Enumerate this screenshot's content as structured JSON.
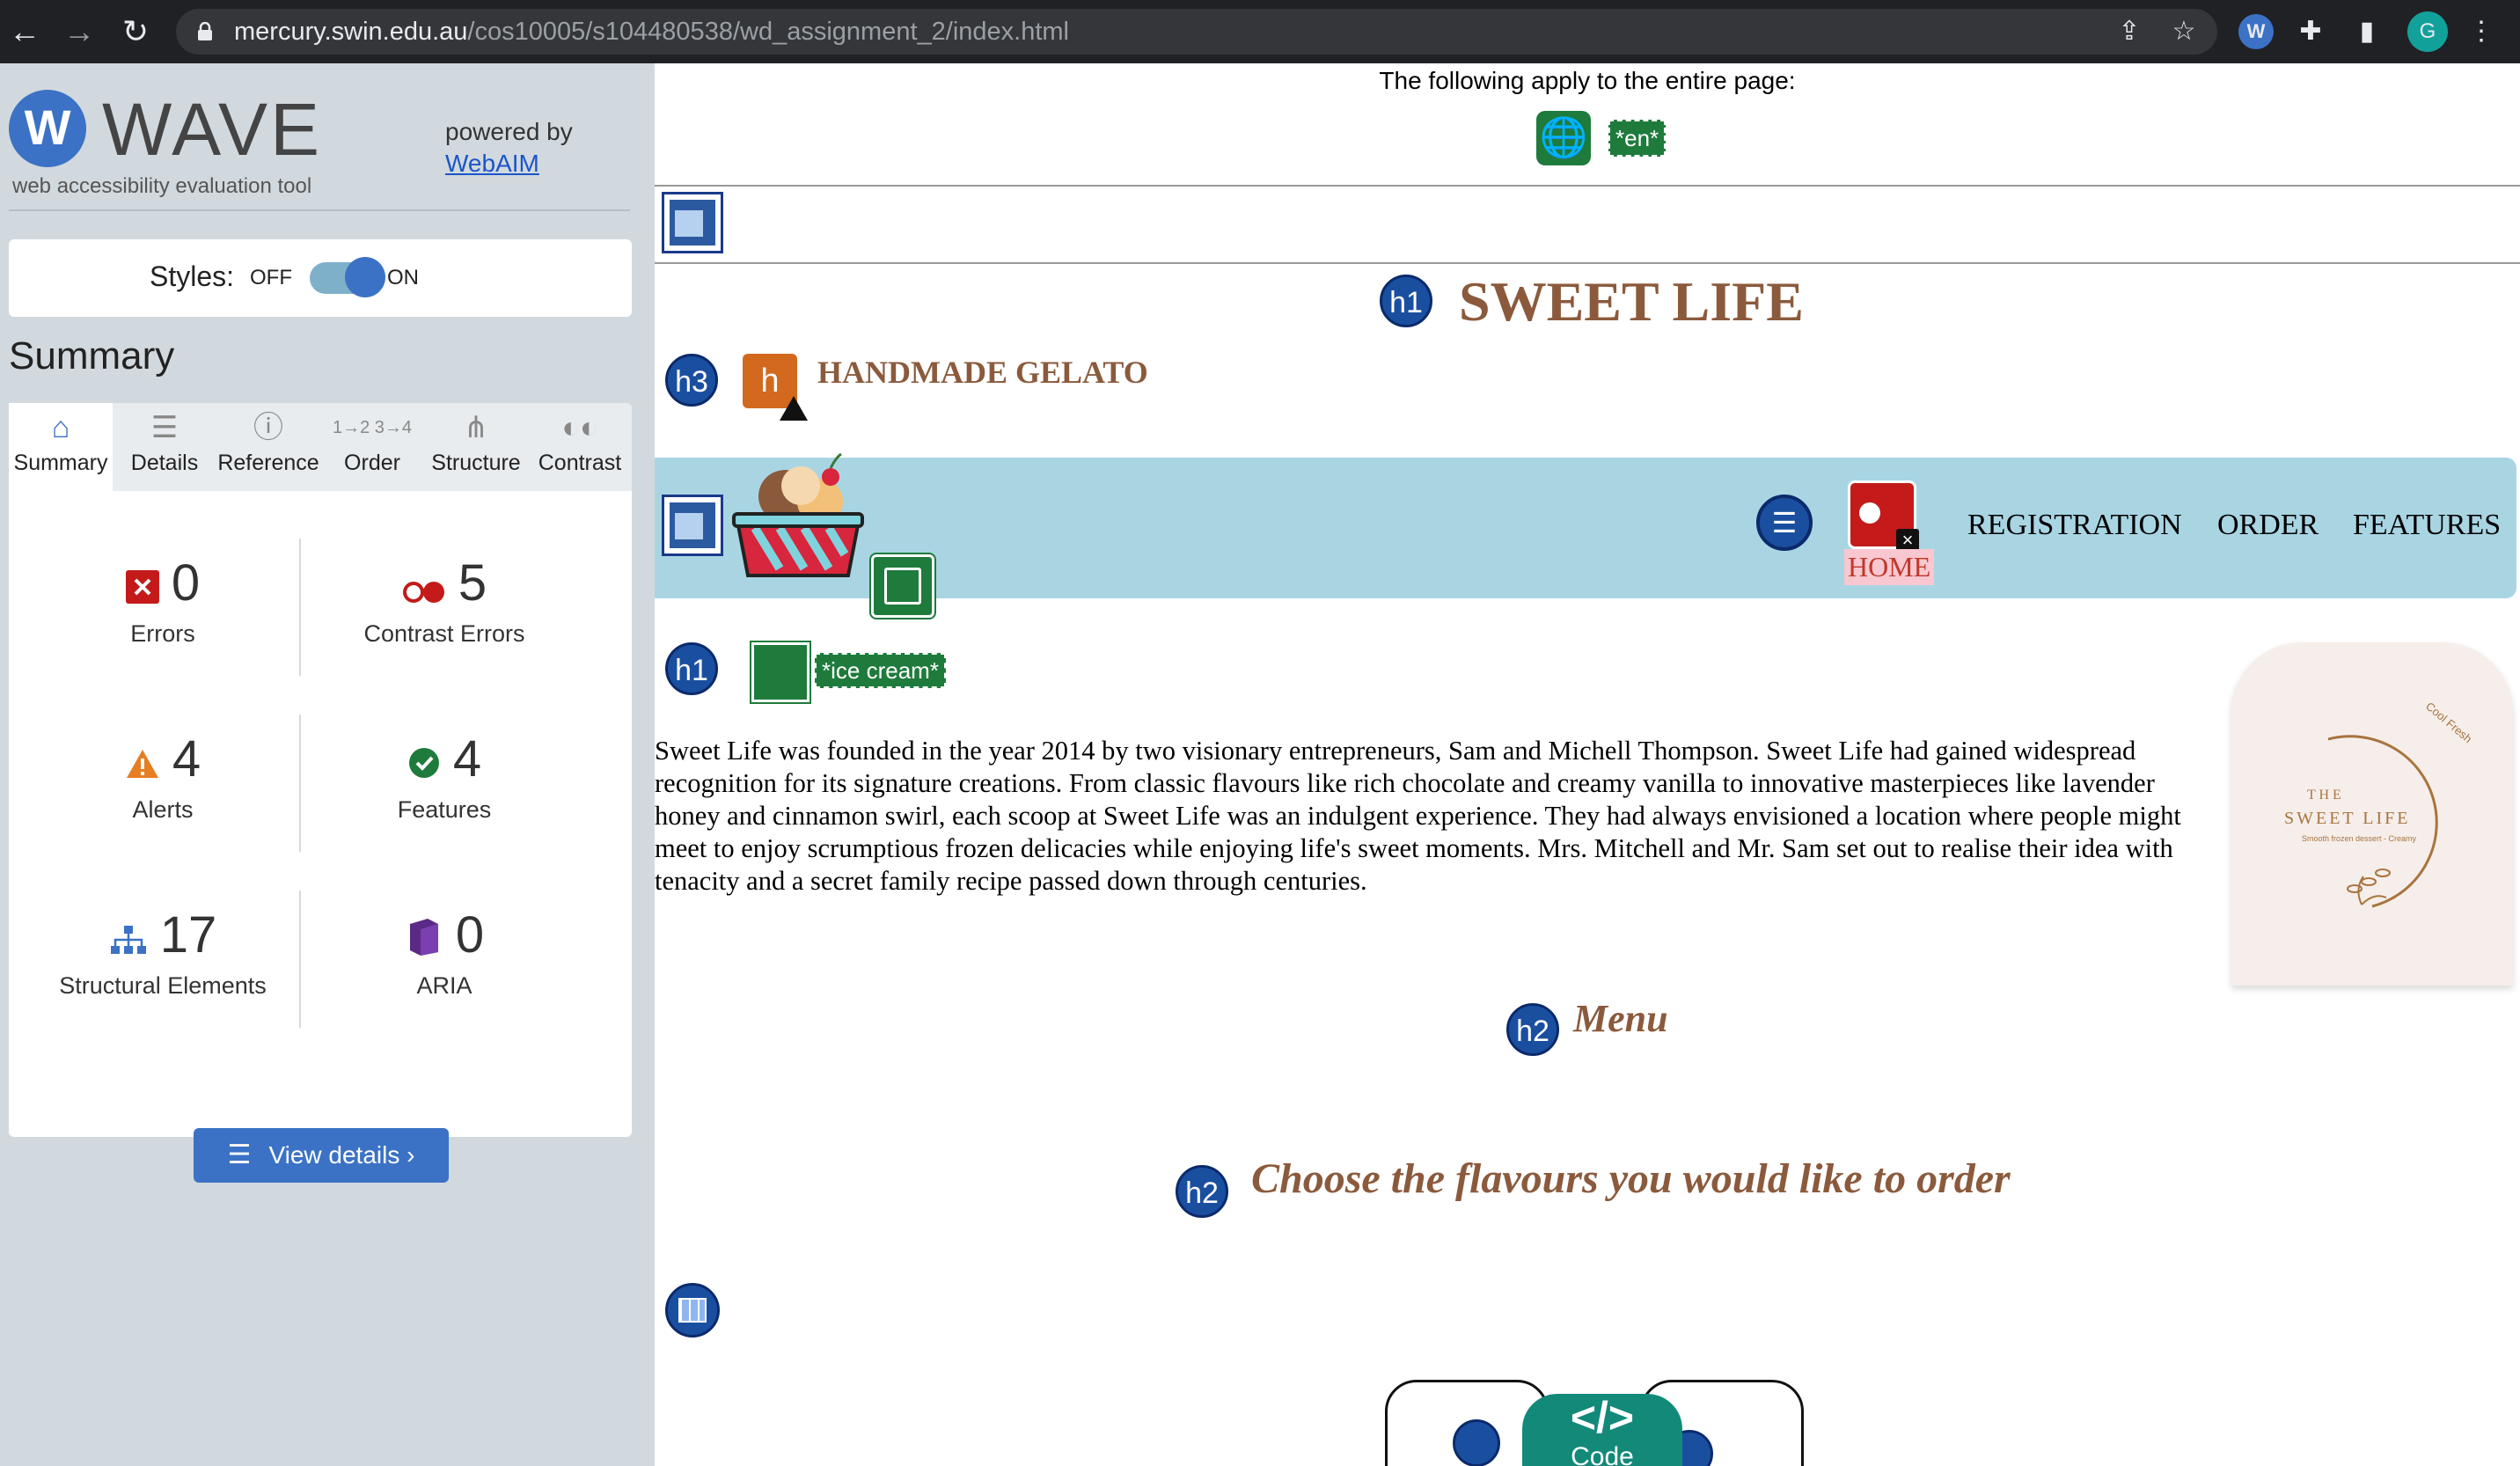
{
  "browser": {
    "url_host": "mercury.swin.edu.au",
    "url_path": "/cos10005/s104480538/wd_assignment_2/index.html",
    "profile_initial": "G"
  },
  "wave": {
    "logo_letter": "W",
    "name": "WAVE",
    "subtitle": "web accessibility evaluation tool",
    "powered_by": "powered by",
    "powered_link": "WebAIM",
    "styles_label": "Styles:",
    "styles_off": "OFF",
    "styles_on": "ON",
    "summary_heading": "Summary",
    "tabs": [
      {
        "label": "Summary",
        "icon": "home-icon",
        "active": true
      },
      {
        "label": "Details",
        "icon": "list-icon"
      },
      {
        "label": "Reference",
        "icon": "info-icon"
      },
      {
        "label": "Order",
        "icon": "order-icon"
      },
      {
        "label": "Structure",
        "icon": "structure-icon"
      },
      {
        "label": "Contrast",
        "icon": "contrast-icon"
      }
    ],
    "stats": {
      "errors": {
        "value": "0",
        "label": "Errors",
        "color": "#c41a1a"
      },
      "contrast": {
        "value": "5",
        "label": "Contrast Errors",
        "color": "#c41a1a"
      },
      "alerts": {
        "value": "4",
        "label": "Alerts",
        "color": "#e67e22"
      },
      "features": {
        "value": "4",
        "label": "Features",
        "color": "#1e7b3c"
      },
      "structural": {
        "value": "17",
        "label": "Structural Elements",
        "color": "#3b72c5"
      },
      "aria": {
        "value": "0",
        "label": "ARIA",
        "color": "#5b2a86"
      }
    },
    "view_details": "View details ›"
  },
  "page": {
    "apply_text": "The following apply to the entire page:",
    "lang_tag": "*en*",
    "h1_badge": "h1",
    "h3_badge": "h3",
    "h2_badge": "h2",
    "title": "SWEET LIFE",
    "subtitle": "HANDMADE GELATO",
    "nav": {
      "home": "HOME",
      "registration": "REGISTRATION",
      "order": "ORDER",
      "features": "FEATURES"
    },
    "alt_tag": "*ice cream*",
    "about_text": "Sweet Life was founded in the year 2014 by two visionary entrepreneurs, Sam and Michell Thompson. Sweet Life had gained widespread recognition for its signature creations. From classic flavours like rich chocolate and creamy vanilla to innovative masterpieces like lavender honey and cinnamon swirl, each scoop at Sweet Life was an indulgent experience. They had always envisioned a location where people might meet to enjoy scrumptious frozen delicacies while enjoying life's sweet moments. Mrs. Mitchell and Mr. Sam set out to realise their idea with tenacity and a secret family recipe passed down through centuries.",
    "logo": {
      "the": "T H E",
      "name": "SWEET LIFE",
      "tagline": "Smooth frozen dessert - Creamy",
      "arc_text": "Cool Fresh"
    },
    "menu_heading": "Menu",
    "choose_heading": "Choose the flavours you would like to order",
    "code_label": "Code",
    "code_symbol": "</>"
  }
}
